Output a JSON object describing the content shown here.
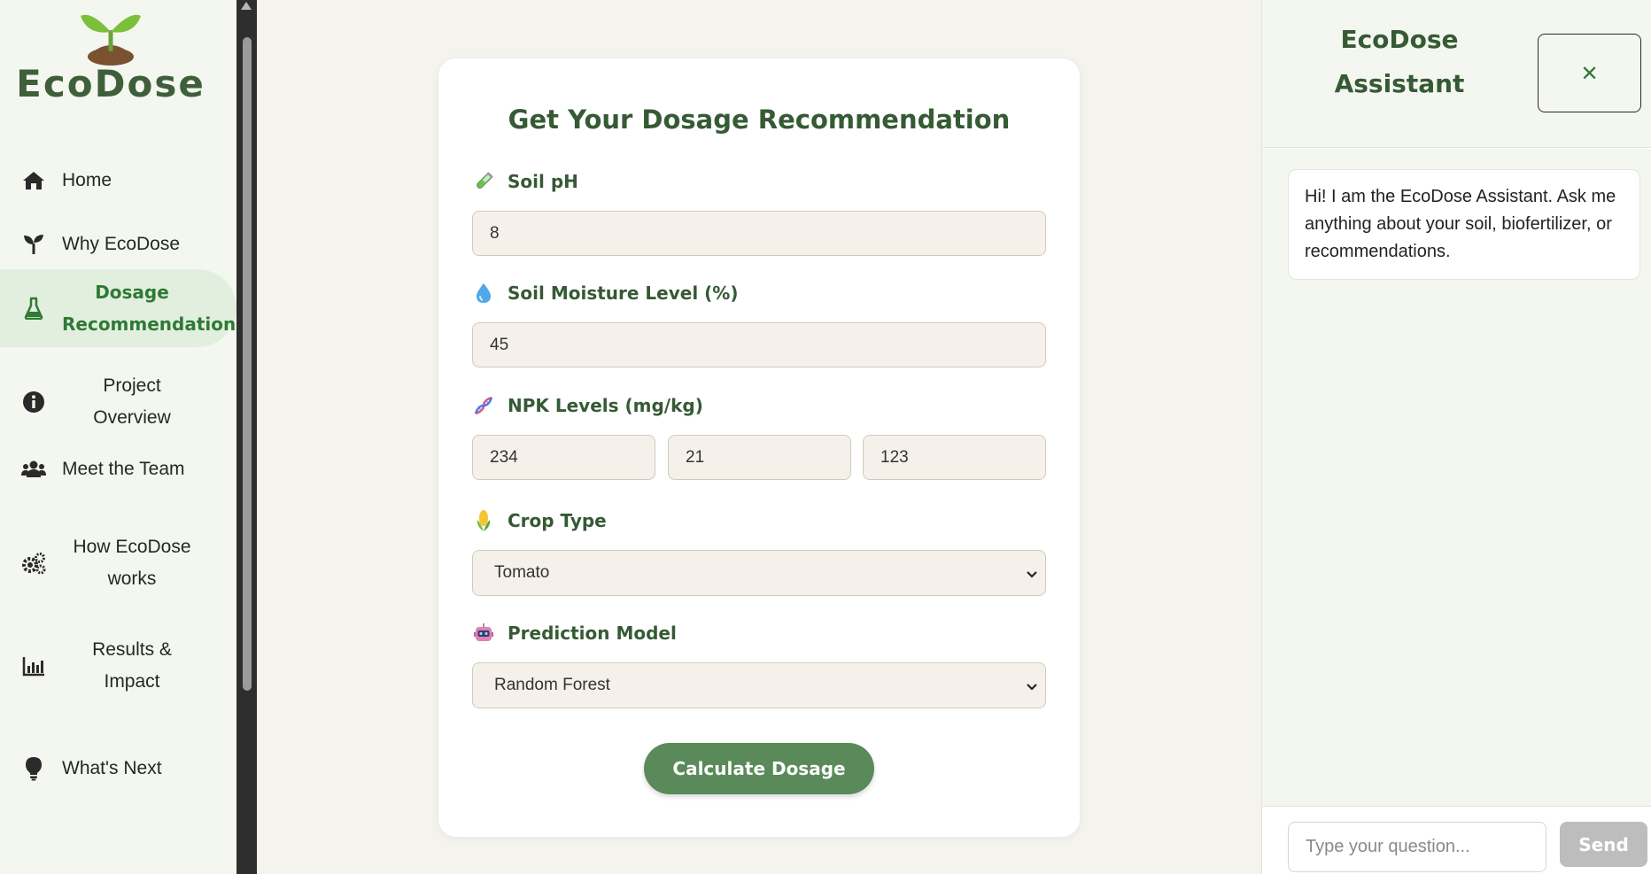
{
  "brand": {
    "name": "EcoDose"
  },
  "nav": {
    "items": [
      {
        "label": "Home",
        "icon": "home-icon"
      },
      {
        "label": "Why EcoDose",
        "icon": "sprout-icon"
      },
      {
        "label_line1": "Dosage",
        "label_line2": "Recommendation",
        "icon": "flask-icon",
        "active": true
      },
      {
        "label_line1": "Project",
        "label_line2": "Overview",
        "icon": "info-icon"
      },
      {
        "label": "Meet the Team",
        "icon": "team-icon"
      },
      {
        "label_line1": "How EcoDose",
        "label_line2": "works",
        "icon": "gears-icon"
      },
      {
        "label_line1": "Results &",
        "label_line2": "Impact",
        "icon": "chart-icon"
      },
      {
        "label": "What's Next",
        "icon": "lightbulb-icon"
      }
    ]
  },
  "form": {
    "title": "Get Your Dosage Recommendation",
    "soil_ph": {
      "label": "Soil pH",
      "value": "8"
    },
    "moisture": {
      "label": "Soil Moisture Level (%)",
      "value": "45"
    },
    "npk": {
      "label": "NPK Levels (mg/kg)",
      "n": "234",
      "p": "21",
      "k": "123"
    },
    "crop": {
      "label": "Crop Type",
      "value": "Tomato"
    },
    "model": {
      "label": "Prediction Model",
      "value": "Random Forest"
    },
    "submit_label": "Calculate Dosage"
  },
  "assistant": {
    "title_line1": "EcoDose",
    "title_line2": "Assistant",
    "close_label": "✕",
    "greeting": "Hi! I am the EcoDose Assistant. Ask me anything about your soil, biofertilizer, or recommendations.",
    "input_placeholder": "Type your question...",
    "send_label": "Send"
  },
  "colors": {
    "brand_green": "#355a34",
    "accent_green": "#2f7a35",
    "button_green": "#5a8a5a",
    "active_nav_bg": "#e2efdf",
    "send_disabled": "#bdbdbd"
  }
}
